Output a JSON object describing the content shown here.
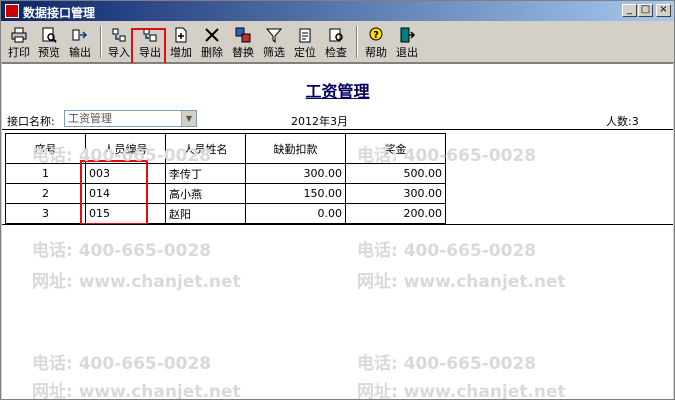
{
  "window": {
    "title": "数据接口管理",
    "controls": {
      "minimize": "_",
      "maximize": "□",
      "close": "×"
    }
  },
  "toolbar": {
    "buttons": [
      {
        "label": "打印",
        "icon": "printer-icon"
      },
      {
        "label": "预览",
        "icon": "preview-icon"
      },
      {
        "label": "输出",
        "icon": "output-icon"
      },
      {
        "label": "导入",
        "icon": "import-icon"
      },
      {
        "label": "导出",
        "icon": "export-icon"
      },
      {
        "label": "增加",
        "icon": "add-icon"
      },
      {
        "label": "删除",
        "icon": "delete-icon"
      },
      {
        "label": "替换",
        "icon": "replace-icon"
      },
      {
        "label": "筛选",
        "icon": "filter-icon"
      },
      {
        "label": "定位",
        "icon": "locate-icon"
      },
      {
        "label": "检查",
        "icon": "check-icon"
      },
      {
        "label": "帮助",
        "icon": "help-icon"
      },
      {
        "label": "退出",
        "icon": "exit-icon"
      }
    ]
  },
  "report": {
    "title": "工资管理",
    "interface_label": "接口名称:",
    "interface_value": "工资管理",
    "period": "2012年3月",
    "count_label": "人数:3"
  },
  "table": {
    "headers": [
      "序号",
      "人员编号",
      "人员姓名",
      "缺勤扣款",
      "奖金"
    ],
    "rows": [
      [
        "1",
        "003",
        "李传丁",
        "300.00",
        "500.00"
      ],
      [
        "2",
        "014",
        "高小燕",
        "150.00",
        "300.00"
      ],
      [
        "3",
        "015",
        "赵阳",
        "0.00",
        "200.00"
      ]
    ]
  },
  "watermark": {
    "phone": "电话: 400-665-0028",
    "site": "网址: www.chanjet.net"
  },
  "colors": {
    "title_bar_start": "#0a246a",
    "title_bar_end": "#a6caf0",
    "highlight": "#e01010",
    "report_title": "#000060"
  }
}
